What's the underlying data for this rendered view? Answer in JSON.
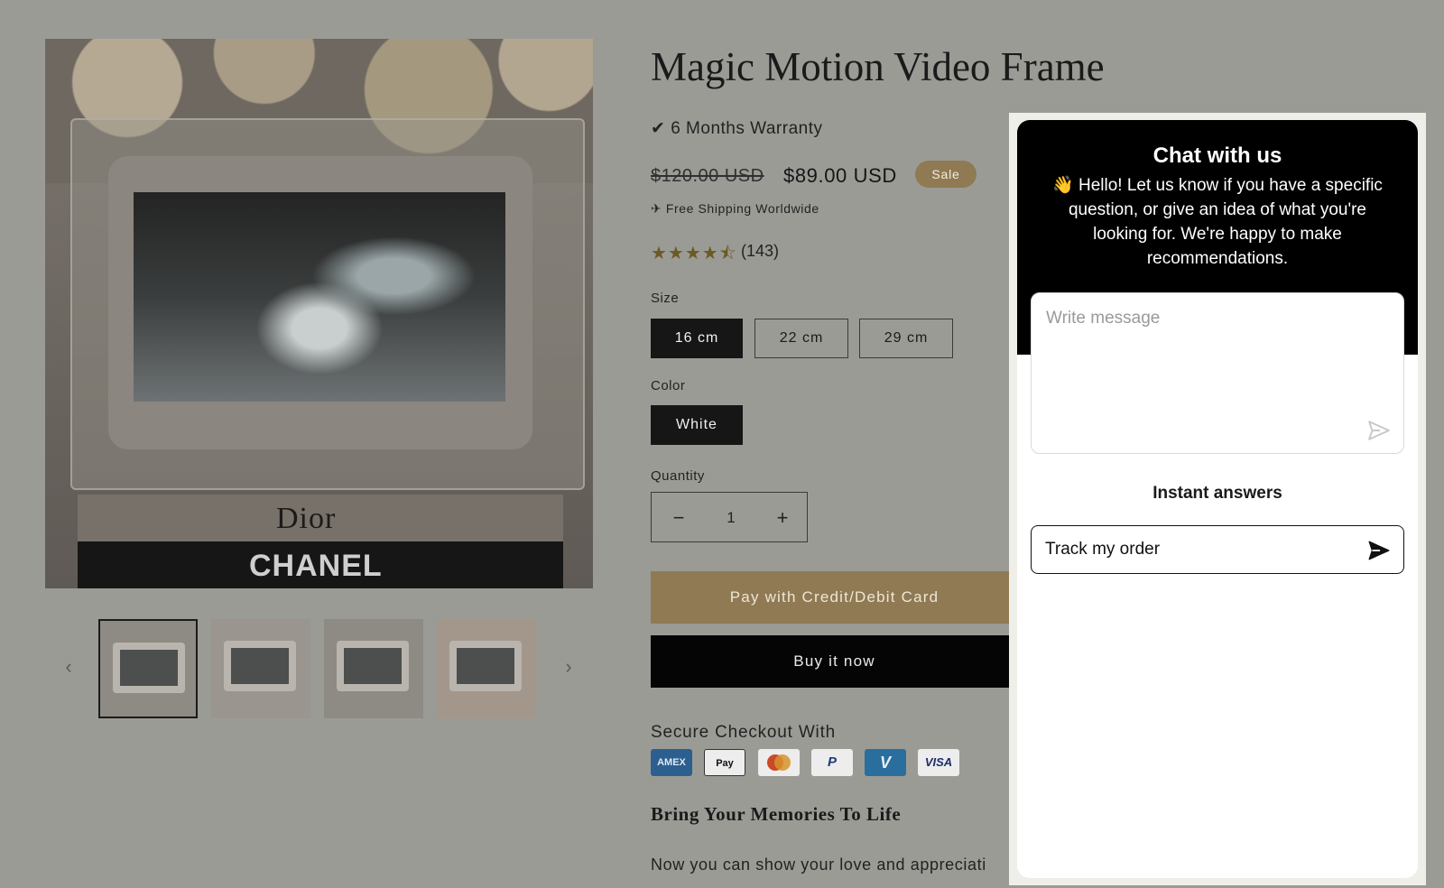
{
  "product": {
    "title": "Magic Motion Video Frame",
    "warranty": "✔ 6 Months Warranty",
    "old_price": "$120.00 USD",
    "new_price": "$89.00 USD",
    "sale_badge": "Sale",
    "shipping": "✈ Free Shipping Worldwide",
    "rating": 4.5,
    "stars": "★★★★⯪",
    "reviews": "(143)"
  },
  "gallery": {
    "book_top": "Dior",
    "book_bottom": "CHANEL",
    "prev_arrow": "‹",
    "next_arrow": "›"
  },
  "options": {
    "size_label": "Size",
    "sizes": [
      "16 cm",
      "22 cm",
      "29 cm"
    ],
    "selected_size": "16 cm",
    "color_label": "Color",
    "colors": [
      "White"
    ],
    "selected_color": "White",
    "quantity_label": "Quantity",
    "quantity": "1",
    "minus": "−",
    "plus": "+"
  },
  "actions": {
    "pay_card": "Pay with Credit/Debit Card",
    "buy_now": "Buy it now"
  },
  "checkout": {
    "secure_label": "Secure Checkout With",
    "methods": [
      "AMEX",
      "Pay",
      "Mastercard",
      "P",
      "V",
      "VISA"
    ]
  },
  "content": {
    "headline": "Bring Your Memories To Life",
    "description": "Now you can show your love and appreciati"
  },
  "chat": {
    "title": "Chat with us",
    "subtitle": "👋 Hello! Let us know if you have a specific question, or give an idea of what you're looking for. We're happy to make recommendations.",
    "placeholder": "Write message",
    "instant_answers": "Instant answers",
    "quick_reply": "Track my order"
  },
  "colors": {
    "accent": "#8f7a54",
    "overlay": "#9b9b96",
    "dark": "#050505"
  }
}
